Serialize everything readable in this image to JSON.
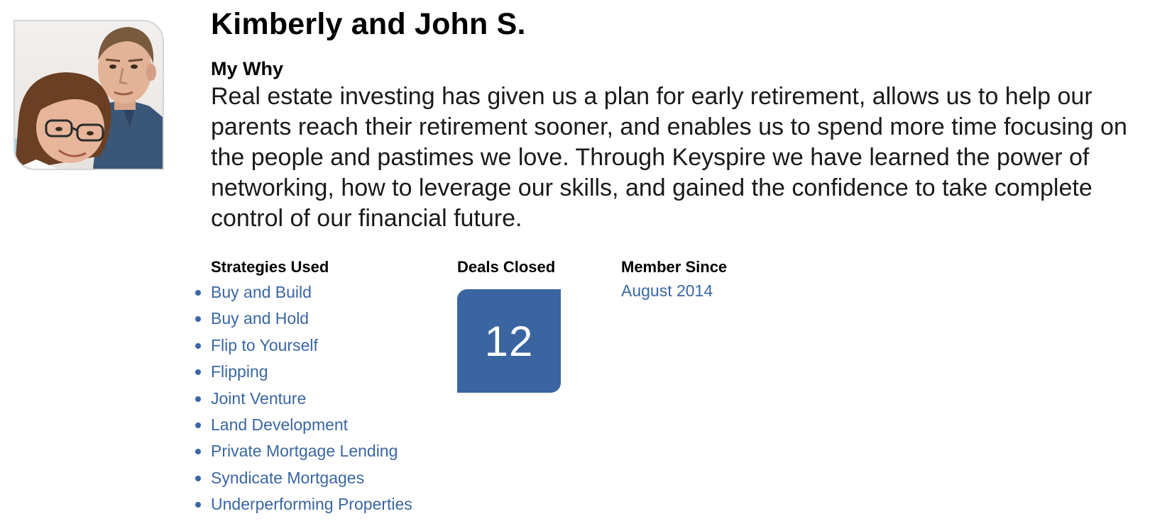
{
  "profile": {
    "name": "Kimberly and John S.",
    "photo_alt": "Kimberly and John S. photo"
  },
  "why": {
    "label": "My Why",
    "text": "Real estate investing has given us a plan for early retirement, allows us to help our parents reach their retirement sooner, and enables us to spend more time focusing on the people and pastimes we love. Through Keyspire we have learned the power of networking, how to leverage our skills, and gained the confidence to take complete control of our financial future."
  },
  "strategies": {
    "label": "Strategies Used",
    "items": [
      "Buy and Build",
      "Buy and Hold",
      "Flip to Yourself",
      "Flipping",
      "Joint Venture",
      "Land Development",
      "Private Mortgage Lending",
      "Syndicate Mortgages",
      "Underperforming Properties"
    ]
  },
  "deals": {
    "label": "Deals Closed",
    "value": "12"
  },
  "member": {
    "label": "Member Since",
    "value": "August 2014"
  },
  "colors": {
    "link": "#3a66a3",
    "badge": "#3a65a0",
    "photo_border": "#d6d6d6"
  }
}
